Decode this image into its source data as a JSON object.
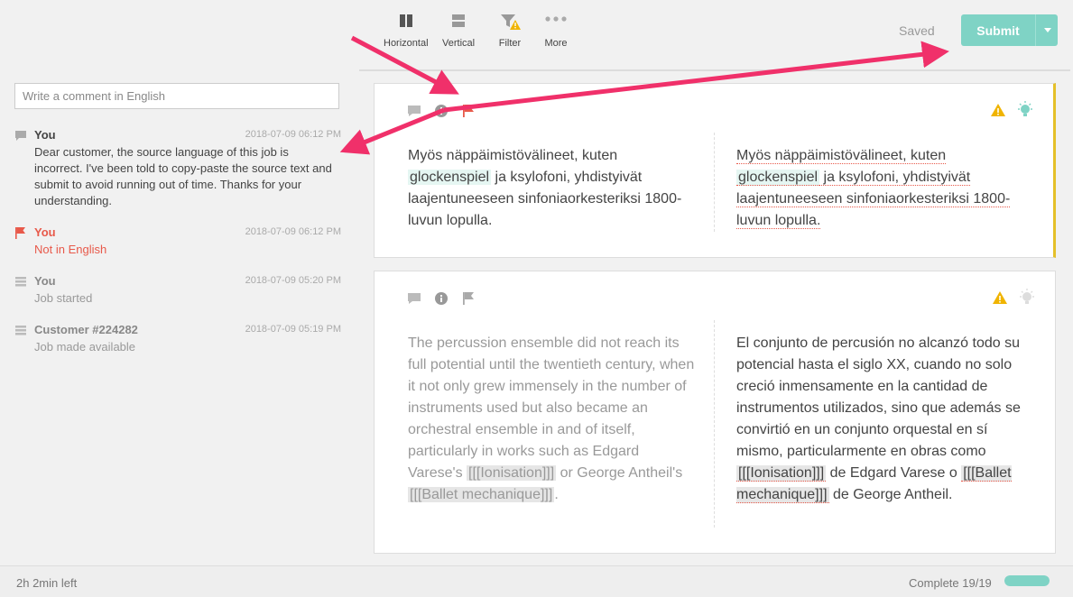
{
  "toolbar": {
    "tools": [
      {
        "label": "Horizontal",
        "icon": "horizontal-layout-icon"
      },
      {
        "label": "Vertical",
        "icon": "vertical-layout-icon"
      },
      {
        "label": "Filter",
        "icon": "filter-warning-icon"
      },
      {
        "label": "More",
        "icon": "more-dots-icon"
      }
    ],
    "saved_label": "Saved",
    "submit_label": "Submit"
  },
  "sidebar": {
    "comment_placeholder": "Write a comment in English",
    "feed": [
      {
        "author": "You",
        "time": "2018-07-09 06:12 PM",
        "text": "Dear customer, the source language of this job is incorrect. I've been told to copy-paste the source text and submit to avoid running out of time. Thanks for your understanding.",
        "icon": "comment-icon"
      },
      {
        "author": "You",
        "time": "2018-07-09 06:12 PM",
        "text": "Not in English",
        "icon": "flag-icon"
      },
      {
        "author": "You",
        "time": "2018-07-09 05:20 PM",
        "text": "Job started",
        "icon": "list-icon"
      },
      {
        "author": "Customer #224282",
        "time": "2018-07-09 05:19 PM",
        "text": "Job made available",
        "icon": "list-icon"
      }
    ]
  },
  "segments": [
    {
      "source": {
        "before": "Myös näppäimistövälineet, kuten ",
        "term": "glockenspiel",
        "after": " ja ksylofoni, yhdistyivät laajentuneeseen sinfoniaorkesteriksi 1800-luvun lopulla."
      },
      "target": {
        "before": "Myös näppäimistövälineet, kuten ",
        "term": "glockenspiel",
        "after": " ja ksylofoni, yhdistyivät laajentuneeseen sinfoniaorkesteriksi 1800-luvun lopulla."
      }
    },
    {
      "source": {
        "p1": "The percussion ensemble did not reach its full potential until the twentieth century, when it not only grew immensely in the number of instruments used but also became an orchestral ensemble in and of itself, particularly in works such as Edgard Varese's ",
        "tag1": "[[[Ionisation]]]",
        "p2": " or George Antheil's ",
        "tag2": "[[[Ballet mechanique]]]",
        "p3": "."
      },
      "target": {
        "p1": "El conjunto de percusión no alcanzó todo su potencial hasta el siglo XX, cuando no solo creció inmensamente en la cantidad de instrumentos utilizados, sino que además se convirtió en un conjunto orquestal en sí mismo, particularmente en obras como ",
        "tag1": "[[[Ionisation]]]",
        "p2": " de Edgard Varese o ",
        "tag2": "[[[Ballet mechanique]]]",
        "p3": " de George Antheil."
      }
    }
  ],
  "footer": {
    "time_left": "2h 2min left",
    "complete": "Complete 19/19",
    "progress": 1.0
  },
  "colors": {
    "accent": "#7fd3c5",
    "flag": "#e8594a",
    "warning": "#f0b400",
    "active_border": "#e5c02a",
    "arrow": "#f0306a"
  }
}
